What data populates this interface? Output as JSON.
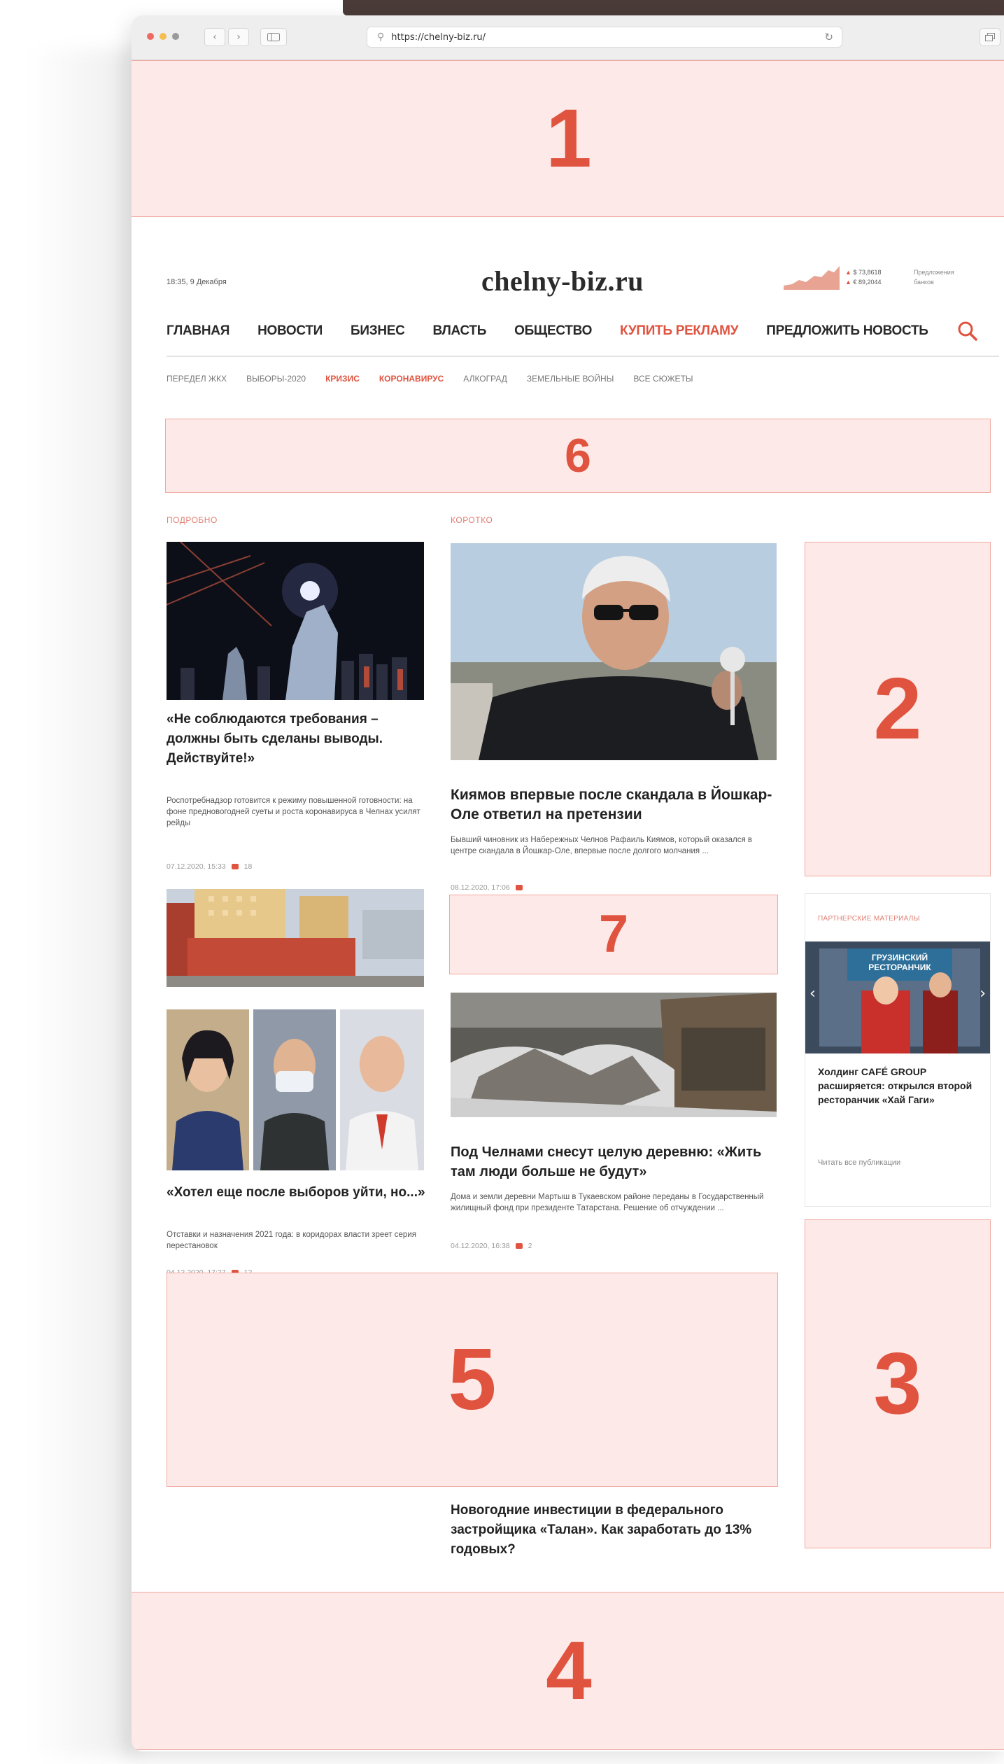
{
  "browser": {
    "url": "https://chelny-biz.ru/"
  },
  "zones": {
    "z1": "1",
    "z2": "2",
    "z3": "3",
    "z4": "4",
    "z5": "5",
    "z6": "6",
    "z7": "7"
  },
  "header": {
    "time": "18:35, 9 Декабря",
    "logo": "chelny-biz.ru",
    "rate_usd": "$ 73,8618",
    "rate_eur": "€ 89,2044",
    "rates_note_1": "Предложения",
    "rates_note_2": "банков"
  },
  "nav": {
    "main": [
      "ГЛАВНАЯ",
      "НОВОСТИ",
      "БИЗНЕС",
      "ВЛАСТЬ",
      "ОБЩЕСТВО",
      "КУПИТЬ РЕКЛАМУ",
      "ПРЕДЛОЖИТЬ НОВОСТЬ"
    ],
    "sub": [
      "ПЕРЕДЕЛ ЖКХ",
      "ВЫБОРЫ-2020",
      "КРИЗИС",
      "КОРОНАВИРУС",
      "АЛКОГРАД",
      "ЗЕМЕЛЬНЫЕ ВОЙНЫ",
      "ВСЕ СЮЖЕТЫ"
    ]
  },
  "sections": {
    "left": "ПОДРОБНО",
    "middle": "КОРОТКО"
  },
  "articles": {
    "a1": {
      "title": "«Не соблюдаются требования – должны быть сделаны выводы. Действуйте!»",
      "lead": "Роспотребнадзор готовится к режиму повышенной готовности: на фоне предновогодней суеты и роста коронавируса в Челнах усилят рейды",
      "date": "07.12.2020, 15:33",
      "comments": "18"
    },
    "a2": {
      "title": "Киямов впервые после скандала в Йошкар-Оле ответил на претензии",
      "lead": "Бывший чиновник из Набережных Челнов Рафаиль Киямов, который оказался в центре скандала в Йошкар-Оле, впервые после долгого молчания ...",
      "date": "08.12.2020, 17:06"
    },
    "a3": {
      "title": "«Хотел еще после выборов уйти, но...»",
      "lead": "Отставки и назначения 2021 года: в коридорах власти зреет серия перестановок",
      "date": "04.12.2020, 17:27",
      "comments": "12"
    },
    "a4": {
      "title": "Под Челнами снесут целую деревню: «Жить там люди больше не будут»",
      "lead": "Дома и земли деревни Мартыш в Тукаевском районе переданы в Государственный жилищный фонд при президенте Татарстана. Решение об отчуждении ...",
      "date": "04.12.2020, 16:38",
      "comments": "2"
    },
    "a5": {
      "title": "Новогодние инвестиции в федерального застройщика «Талан». Как заработать до 13% годовых?"
    }
  },
  "partner": {
    "label": "ПАРТНЕРСКИЕ МАТЕРИАЛЫ",
    "sign": "ГРУЗИНСКИЙ РЕСТОРАНЧИК",
    "title": "Холдинг CAFÉ GROUP расширяется: открылся второй ресторанчик «Хай Гаги»",
    "link": "Читать все публикации"
  }
}
